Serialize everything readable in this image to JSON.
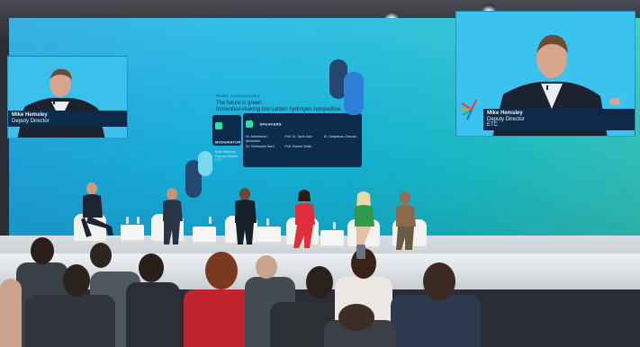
{
  "photo": {
    "subject": "Panel discussion on stage in front of a large LED wall"
  },
  "slide": {
    "label": "PANEL DISCUSSION 1",
    "title_line1": "The future is green:",
    "title_line2": "Innovation-making low carbon hydrogen competitive",
    "moderator_header": "MODERATOR",
    "moderator_name": "Mike Hemsley",
    "moderator_role": "Deputy Director",
    "moderator_org": "ETC",
    "speakers_header": "SPEAKERS",
    "speakers": [
      {
        "name": "Dr. Abdulrahim Almulhem"
      },
      {
        "name": "Prof. Dr. Tarek Aziz"
      },
      {
        "name": "Dr. Sanjeevan Guruam"
      },
      {
        "name": "Dr. Christophe Barri"
      },
      {
        "name": "Prof. Rachel Smith"
      }
    ]
  },
  "side_screen_left": {
    "caption_name": "Mike Hemsley",
    "caption_role": "Deputy Director"
  },
  "side_screen_right": {
    "caption_name": "Mike Hemsley",
    "caption_role": "Deputy Director",
    "caption_org": "ETC"
  },
  "colors": {
    "led_wall": "#17b4e4",
    "card_bg": "#0c2c4b",
    "accent_green": "#2ee39e",
    "pill_dark": "#23476f",
    "pill_light": "#7ad7f2"
  }
}
